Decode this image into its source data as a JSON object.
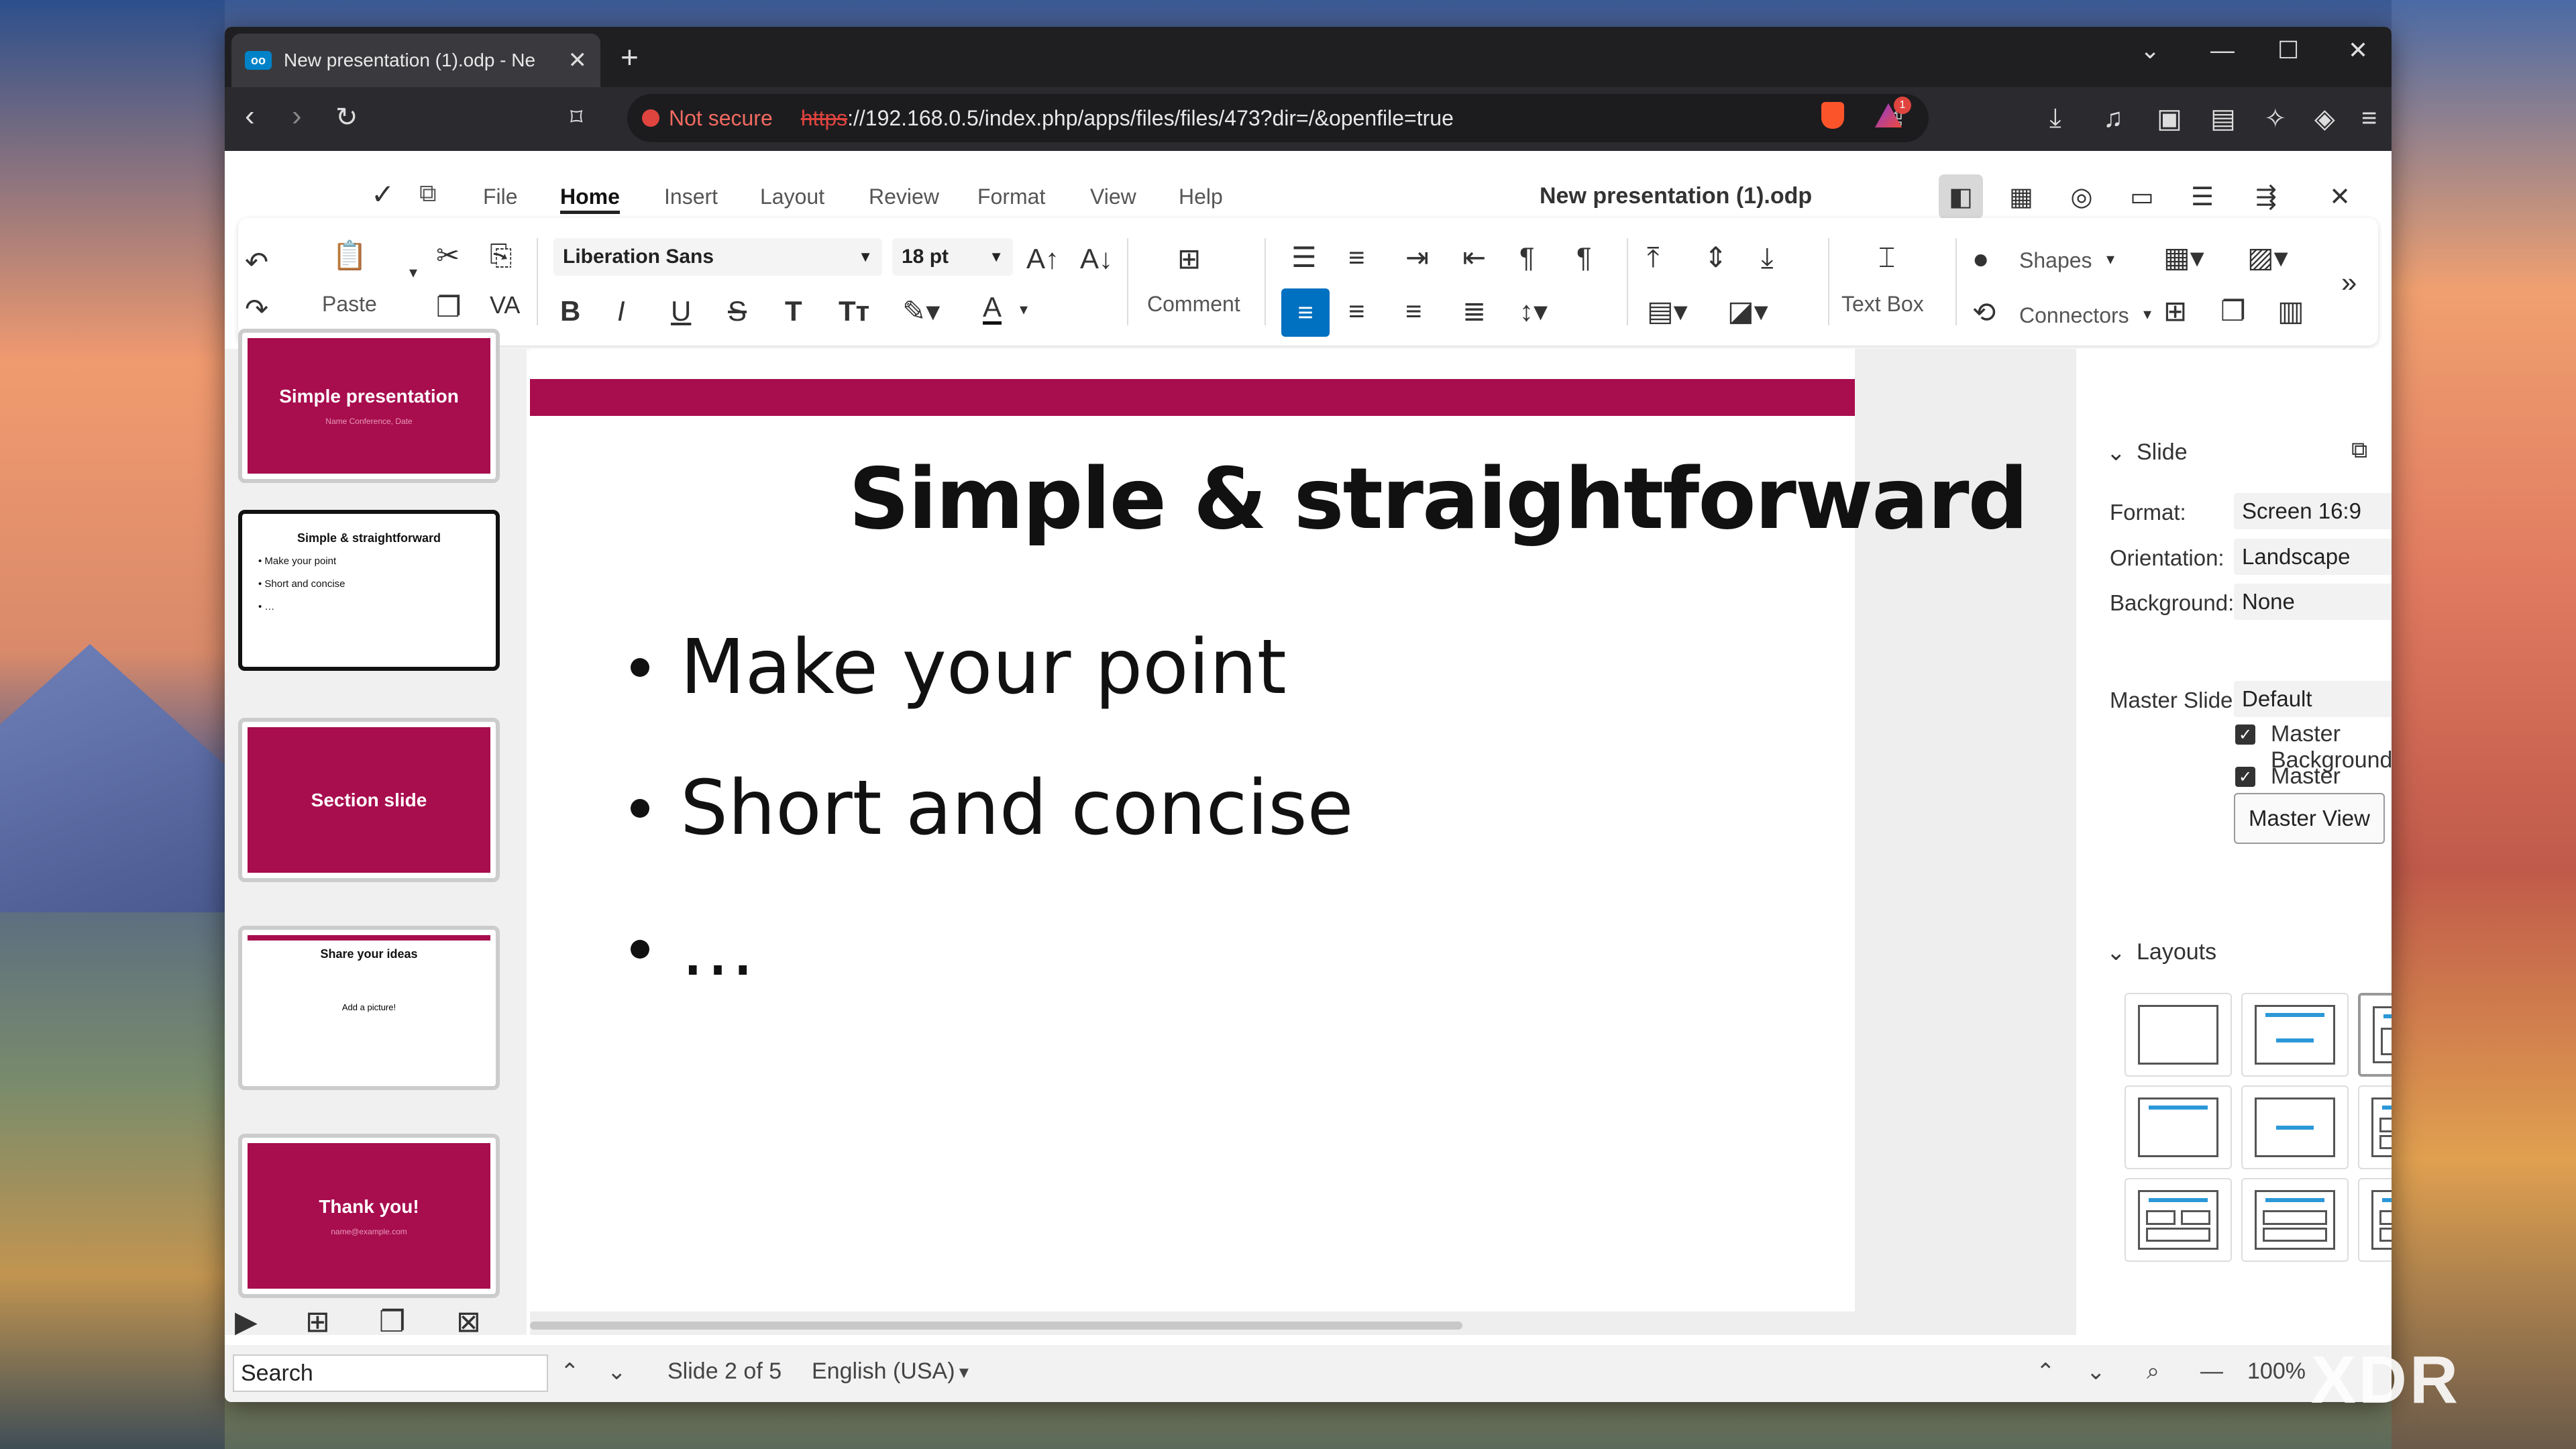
{
  "browser": {
    "tab_title": "New presentation (1).odp - Ne",
    "not_secure": "Not secure",
    "url_scheme": "https",
    "url_rest": "://192.168.0.5/index.php/apps/files/files/473?dir=/&openfile=true",
    "alert_count": "1"
  },
  "menu": {
    "items": [
      "File",
      "Home",
      "Insert",
      "Layout",
      "Review",
      "Format",
      "View",
      "Help"
    ],
    "active": "Home",
    "doc_title": "New presentation (1).odp"
  },
  "ribbon": {
    "paste": "Paste",
    "font": "Liberation Sans",
    "size": "18 pt",
    "comment": "Comment",
    "textbox": "Text Box",
    "shapes": "Shapes",
    "connectors": "Connectors"
  },
  "slides": [
    {
      "title": "Simple presentation",
      "sub": "Name\nConference, Date"
    },
    {
      "title": "Simple & straightforward",
      "bullets": [
        "• Make your point",
        "• Short and concise",
        "• …"
      ]
    },
    {
      "title": "Section slide"
    },
    {
      "title": "Share your ideas",
      "sub": "Add a picture!"
    },
    {
      "title": "Thank you!",
      "sub": "name@example.com"
    }
  ],
  "slide": {
    "title": "Simple & straightforward",
    "bullets": [
      "Make your point",
      "Short and concise",
      "…"
    ]
  },
  "sidebar": {
    "section": "Slide",
    "format_label": "Format:",
    "format": "Screen 16:9",
    "orientation_label": "Orientation:",
    "orientation": "Landscape",
    "background_label": "Background:",
    "background": "None",
    "master_label": "Master Slide:",
    "master": "Default",
    "master_bg": "Master Background",
    "master_obj": "Master Objects",
    "master_view": "Master View",
    "layouts": "Layouts"
  },
  "status": {
    "search": "Search",
    "slide": "Slide 2 of 5",
    "lang": "English (USA)",
    "zoom": "100%"
  },
  "watermark": "XDR",
  "colors": {
    "accent": "#a80d4e",
    "select": "#0070c0"
  }
}
